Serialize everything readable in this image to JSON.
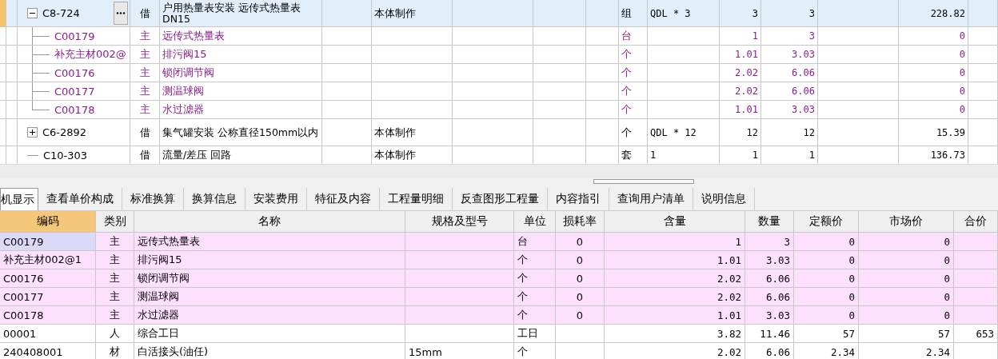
{
  "top_grid": {
    "rows": [
      {
        "code": "C8-724",
        "expanded": true,
        "selected": true,
        "type": "借",
        "name": "户用热量表安装 远传式热量表 DN15",
        "content": "本体制作",
        "unit": "组",
        "expression": "QDL * 3",
        "quantity_1": "3",
        "quantity_2": "3",
        "price": "228.82",
        "children": [
          {
            "code": "C00179",
            "type": "主",
            "name": "远传式热量表",
            "unit": "台",
            "quantity_1": "1",
            "quantity_2": "3",
            "price": "0"
          },
          {
            "code": "补充主材002@",
            "type": "主",
            "name": "排污阀15",
            "unit": "个",
            "quantity_1": "1.01",
            "quantity_2": "3.03",
            "price": "0"
          },
          {
            "code": "C00176",
            "type": "主",
            "name": "锁闭调节阀",
            "unit": "个",
            "quantity_1": "2.02",
            "quantity_2": "6.06",
            "price": "0"
          },
          {
            "code": "C00177",
            "type": "主",
            "name": "测温球阀",
            "unit": "个",
            "quantity_1": "2.02",
            "quantity_2": "6.06",
            "price": "0"
          },
          {
            "code": "C00178",
            "type": "主",
            "name": "水过滤器",
            "unit": "个",
            "quantity_1": "1.01",
            "quantity_2": "3.03",
            "price": "0"
          }
        ]
      },
      {
        "code": "C6-2892",
        "expanded": false,
        "selected": false,
        "type": "借",
        "name": "集气罐安装 公称直径150mm以内",
        "content": "本体制作",
        "unit": "个",
        "expression": "QDL * 12",
        "quantity_1": "12",
        "quantity_2": "12",
        "price": "15.39"
      },
      {
        "code": "C10-303",
        "selected": false,
        "type": "借",
        "name": "流量/差压 回路",
        "content": "本体制作",
        "unit": "套",
        "expression": "1",
        "quantity_1": "1",
        "quantity_2": "1",
        "price": "136.73"
      }
    ]
  },
  "tabs": [
    {
      "label": "机显示",
      "selected": true
    },
    {
      "label": "查看单价构成",
      "selected": false
    },
    {
      "label": "标准换算",
      "selected": false
    },
    {
      "label": "换算信息",
      "selected": false
    },
    {
      "label": "安装费用",
      "selected": false
    },
    {
      "label": "特征及内容",
      "selected": false
    },
    {
      "label": "工程量明细",
      "selected": false
    },
    {
      "label": "反查图形工程量",
      "selected": false
    },
    {
      "label": "内容指引",
      "selected": false
    },
    {
      "label": "查询用户清单",
      "selected": false
    },
    {
      "label": "说明信息",
      "selected": false
    }
  ],
  "detail_table": {
    "columns": [
      {
        "label": "编码",
        "selected": true
      },
      {
        "label": "类别",
        "selected": false
      },
      {
        "label": "名称",
        "selected": false
      },
      {
        "label": "规格及型号",
        "selected": false
      },
      {
        "label": "单位",
        "selected": false
      },
      {
        "label": "损耗率",
        "selected": false
      },
      {
        "label": "含量",
        "selected": false
      },
      {
        "label": "数量",
        "selected": false
      },
      {
        "label": "定额价",
        "selected": false
      },
      {
        "label": "市场价",
        "selected": false
      },
      {
        "label": "合价",
        "selected": false
      }
    ],
    "rows": [
      {
        "kind": "main",
        "selected": true,
        "cells": [
          "C00179",
          "主",
          "远传式热量表",
          "",
          "台",
          "0",
          "1",
          "3",
          "0",
          "0",
          ""
        ]
      },
      {
        "kind": "main",
        "selected": false,
        "cells": [
          "补充主材002@1",
          "主",
          "排污阀15",
          "",
          "个",
          "0",
          "1.01",
          "3.03",
          "0",
          "0",
          ""
        ]
      },
      {
        "kind": "main",
        "selected": false,
        "cells": [
          "C00176",
          "主",
          "锁闭调节阀",
          "",
          "个",
          "0",
          "2.02",
          "6.06",
          "0",
          "0",
          ""
        ]
      },
      {
        "kind": "main",
        "selected": false,
        "cells": [
          "C00177",
          "主",
          "测温球阀",
          "",
          "个",
          "0",
          "2.02",
          "6.06",
          "0",
          "0",
          ""
        ]
      },
      {
        "kind": "main",
        "selected": false,
        "cells": [
          "C00178",
          "主",
          "水过滤器",
          "",
          "个",
          "0",
          "1.01",
          "3.03",
          "0",
          "0",
          ""
        ]
      },
      {
        "kind": "labor",
        "selected": false,
        "cells": [
          "00001",
          "人",
          "综合工日",
          "",
          "工日",
          "",
          "3.82",
          "11.46",
          "57",
          "57",
          "653"
        ]
      },
      {
        "kind": "material",
        "selected": false,
        "cells": [
          "240408001",
          "材",
          "白活接头(油任)",
          "15mm",
          "个",
          "",
          "2.02",
          "6.06",
          "2.34",
          "2.34",
          ""
        ]
      }
    ]
  }
}
